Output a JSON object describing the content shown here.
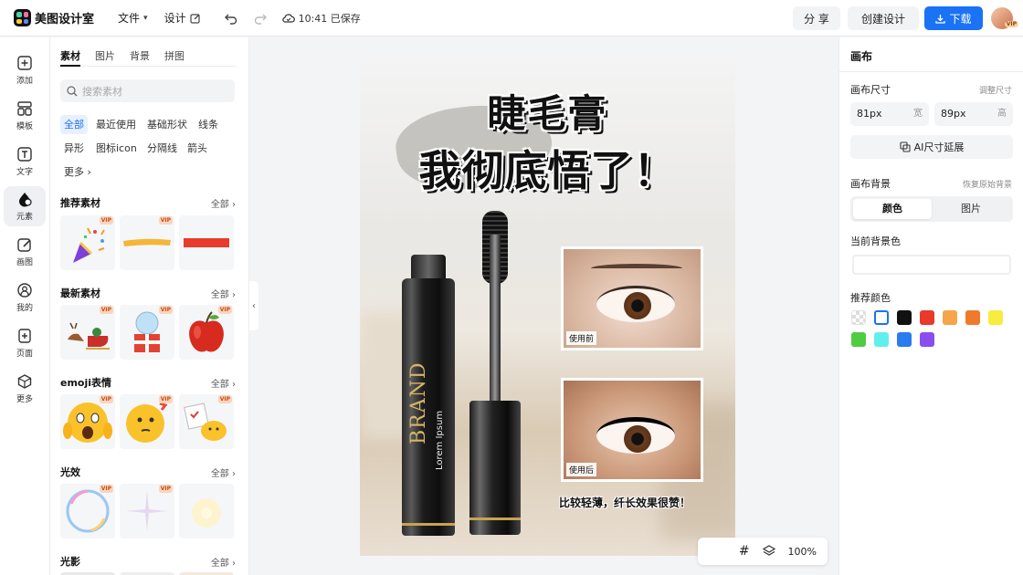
{
  "app": {
    "name": "美图设计室"
  },
  "topbar": {
    "file_menu": "文件",
    "design_menu": "设计",
    "save_status": "10:41 已保存",
    "share": "分 享",
    "create_design": "创建设计",
    "download": "下载",
    "avatar_badge": "VIP"
  },
  "rail": {
    "items": [
      {
        "label": "添加",
        "icon": "plus-square-icon"
      },
      {
        "label": "模板",
        "icon": "template-grid-icon"
      },
      {
        "label": "文字",
        "icon": "text-icon"
      },
      {
        "label": "元素",
        "icon": "element-shapes-icon"
      },
      {
        "label": "画图",
        "icon": "draw-icon"
      },
      {
        "label": "我的",
        "icon": "user-icon"
      },
      {
        "label": "页面",
        "icon": "add-page-icon"
      },
      {
        "label": "更多",
        "icon": "cube-icon"
      }
    ]
  },
  "assets": {
    "tabs": [
      "素材",
      "图片",
      "背景",
      "拼图"
    ],
    "search_placeholder": "搜索素材",
    "chips": [
      "全部",
      "最近使用",
      "基础形状",
      "线条",
      "异形",
      "图标icon",
      "分隔线",
      "箭头",
      "更多"
    ],
    "all_label": "全部",
    "vip_badge": "VIP",
    "sections": [
      {
        "title": "推荐素材"
      },
      {
        "title": "最新素材"
      },
      {
        "title": "emoji表情"
      },
      {
        "title": "光效"
      },
      {
        "title": "光影"
      }
    ]
  },
  "poster": {
    "headline_line1": "睫毛膏",
    "headline_line2": "我彻底悟了！",
    "brand": "BRAND",
    "brand_sub": "Lorem Ipsum",
    "before_label": "使用前",
    "after_label": "使用后",
    "caption": "比较轻薄，纤长效果很赞！"
  },
  "zoom": {
    "level": "100%"
  },
  "canvas_panel": {
    "title": "画布",
    "size_label": "画布尺寸",
    "adjust_size": "调整尺寸",
    "width_value": "81px",
    "width_unit": "宽",
    "height_value": "89px",
    "height_unit": "高",
    "ai_extend": "AI尺寸延展",
    "bg_label": "画布背景",
    "restore_bg": "恢复原始背景",
    "seg_color": "颜色",
    "seg_image": "图片",
    "current_bg": "当前背景色",
    "recommended": "推荐颜色",
    "swatches": [
      "transparent",
      "#ffffff",
      "#111111",
      "#e8392b",
      "#f5a64a",
      "#ef7b2a",
      "#f7ec3f",
      "#4fcc41",
      "#5ff0ee",
      "#2a7af0",
      "#8a4ef0"
    ]
  }
}
